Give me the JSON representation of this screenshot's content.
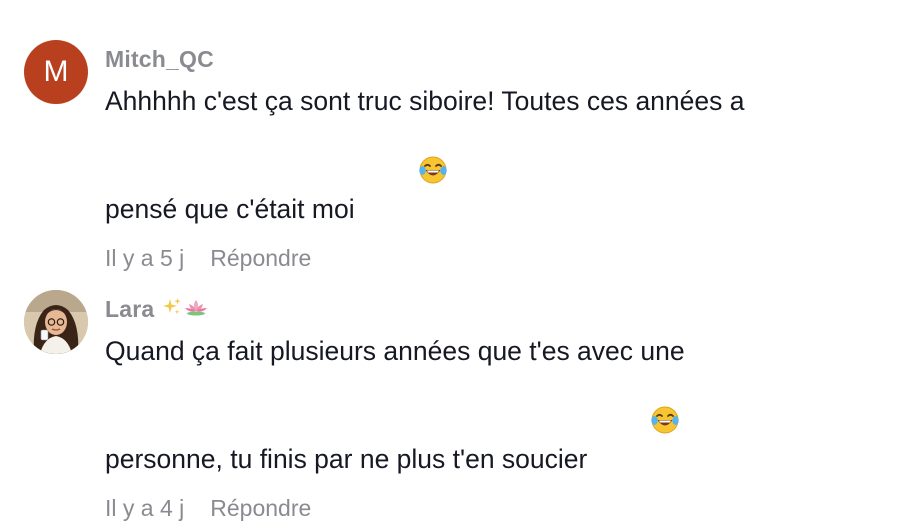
{
  "comments": [
    {
      "avatar_letter": "M",
      "avatar_color": "#b8401f",
      "username": "Mitch_QC",
      "text": "Ahhhhh c'est ça sont truc siboire! Toutes ces années a\npensé que c'était moi",
      "emoji": "face-with-tears-of-joy",
      "time": "Il y a 5 j",
      "reply_label": "Répondre"
    },
    {
      "avatar": "profile-photo",
      "username": "Lara",
      "username_decorations": [
        "sparkles-icon",
        "lotus-icon"
      ],
      "text": "Quand ça fait plusieurs années que t'es avec une\npersonne, tu finis par ne plus t'en soucier",
      "emoji": "face-with-tears-of-joy",
      "time": "Il y a 4 j",
      "reply_label": "Répondre"
    }
  ],
  "colors": {
    "text": "#161823",
    "muted": "#8a8b91",
    "background": "#ffffff"
  }
}
